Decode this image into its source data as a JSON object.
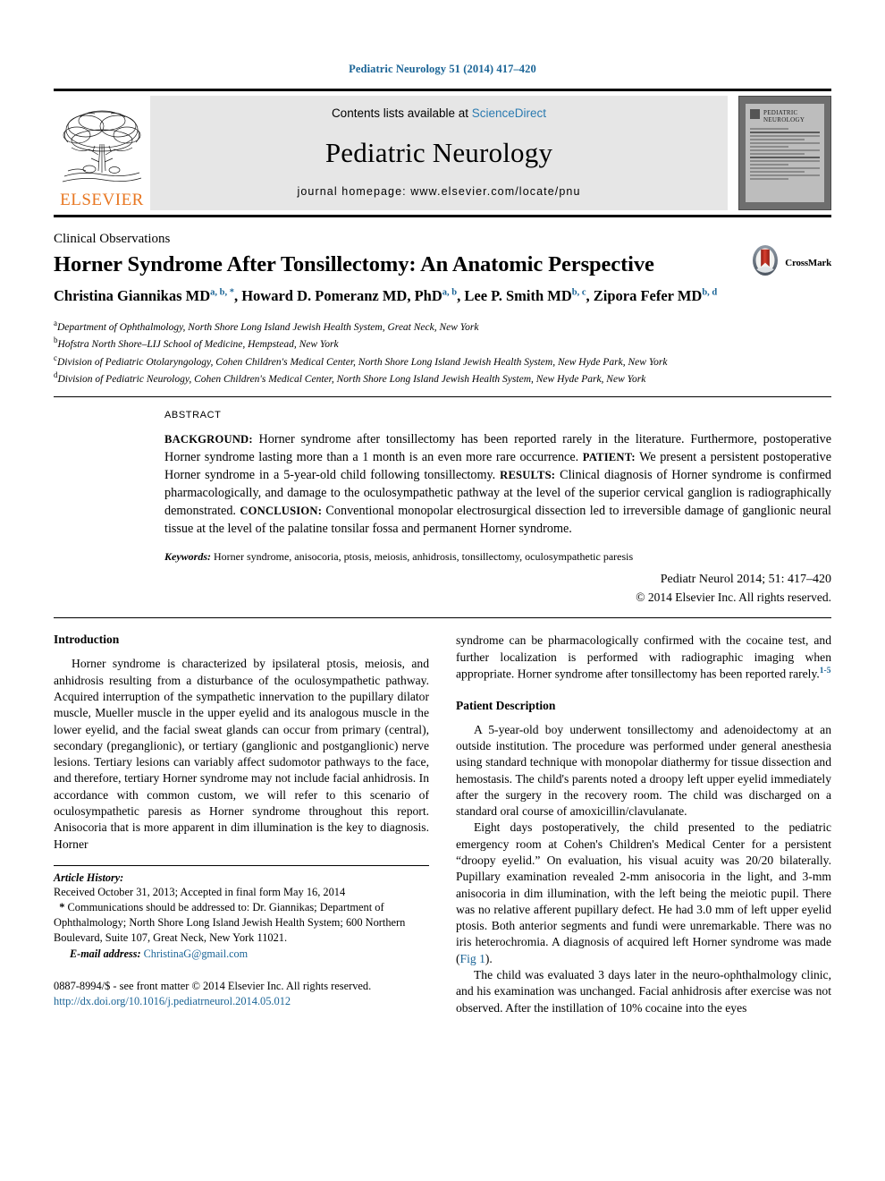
{
  "running_head": "Pediatric Neurology 51 (2014) 417–420",
  "masthead": {
    "publisher_name": "ELSEVIER",
    "contents_prefix": "Contents lists available at ",
    "contents_link": "ScienceDirect",
    "journal_title": "Pediatric Neurology",
    "homepage_line": "journal homepage: www.elsevier.com/locate/pnu",
    "cover_title_line1": "PEDIATRIC",
    "cover_title_line2": "NEUROLOGY"
  },
  "article": {
    "kicker": "Clinical Observations",
    "title": "Horner Syndrome After Tonsillectomy: An Anatomic Perspective",
    "crossmark_label": "CrossMark",
    "authors": [
      {
        "name": "Christina Giannikas MD",
        "marks": "a, b, *",
        "sep": ", "
      },
      {
        "name": "Howard D. Pomeranz MD, PhD",
        "marks": "a, b",
        "sep": ", "
      },
      {
        "name": "Lee P. Smith MD",
        "marks": "b, c",
        "sep": ", "
      },
      {
        "name": "Zipora Fefer MD",
        "marks": "b, d",
        "sep": ""
      }
    ],
    "affiliations": [
      {
        "mark": "a",
        "text": "Department of Ophthalmology, North Shore Long Island Jewish Health System, Great Neck, New York"
      },
      {
        "mark": "b",
        "text": "Hofstra North Shore–LIJ School of Medicine, Hempstead, New York"
      },
      {
        "mark": "c",
        "text": "Division of Pediatric Otolaryngology, Cohen Children's Medical Center, North Shore Long Island Jewish Health System, New Hyde Park, New York"
      },
      {
        "mark": "d",
        "text": "Division of Pediatric Neurology, Cohen Children's Medical Center, North Shore Long Island Jewish Health System, New Hyde Park, New York"
      }
    ]
  },
  "abstract": {
    "label": "ABSTRACT",
    "segments": [
      {
        "head": "BACKGROUND:",
        "text": " Horner syndrome after tonsillectomy has been reported rarely in the literature. Furthermore, postoperative Horner syndrome lasting more than a 1 month is an even more rare occurrence. "
      },
      {
        "head": "PATIENT:",
        "text": " We present a persistent postoperative Horner syndrome in a 5-year-old child following tonsillectomy. "
      },
      {
        "head": "RESULTS:",
        "text": " Clinical diagnosis of Horner syndrome is confirmed pharmacologically, and damage to the oculosympathetic pathway at the level of the superior cervical ganglion is radiographically demonstrated. "
      },
      {
        "head": "CONCLUSION:",
        "text": " Conventional monopolar electrosurgical dissection led to irreversible damage of ganglionic neural tissue at the level of the palatine tonsilar fossa and permanent Horner syndrome."
      }
    ],
    "keywords_label": "Keywords:",
    "keywords": " Horner syndrome, anisocoria, ptosis, meiosis, anhidrosis, tonsillectomy, oculosympathetic paresis",
    "citation": "Pediatr Neurol 2014; 51: 417–420",
    "copyright": "© 2014 Elsevier Inc. All rights reserved."
  },
  "left_column": {
    "heading": "Introduction",
    "paragraph1": "Horner syndrome is characterized by ipsilateral ptosis, meiosis, and anhidrosis resulting from a disturbance of the oculosympathetic pathway. Acquired interruption of the sympathetic innervation to the pupillary dilator muscle, Mueller muscle in the upper eyelid and its analogous muscle in the lower eyelid, and the facial sweat glands can occur from primary (central), secondary (preganglionic), or tertiary (ganglionic and postganglionic) nerve lesions. Tertiary lesions can variably affect sudomotor pathways to the face, and therefore, tertiary Horner syndrome may not include facial anhidrosis. In accordance with common custom, we will refer to this scenario of oculosympathetic paresis as Horner syndrome throughout this report. Anisocoria that is more apparent in dim illumination is the key to diagnosis. Horner",
    "article_history_label": "Article History:",
    "article_history_dates": "Received October 31, 2013; Accepted in final form May 16, 2014",
    "correspondence": "Communications should be addressed to: Dr. Giannikas; Department of Ophthalmology; North Shore Long Island Jewish Health System; 600 Northern Boulevard, Suite 107, Great Neck, New York 11021.",
    "email_label": "E-mail address:",
    "email": "ChristinaG@gmail.com",
    "issn_line": "0887-8994/$ - see front matter © 2014 Elsevier Inc. All rights reserved.",
    "doi_line": "http://dx.doi.org/10.1016/j.pediatrneurol.2014.05.012"
  },
  "right_column": {
    "paragraph_cont": "syndrome can be pharmacologically confirmed with the cocaine test, and further localization is performed with radiographic imaging when appropriate. Horner syndrome after tonsillectomy has been reported rarely.",
    "paragraph_cont_ref": "1-5",
    "heading": "Patient Description",
    "paragraph1": "A 5-year-old boy underwent tonsillectomy and adenoidectomy at an outside institution. The procedure was performed under general anesthesia using standard technique with monopolar diathermy for tissue dissection and hemostasis. The child's parents noted a droopy left upper eyelid immediately after the surgery in the recovery room. The child was discharged on a standard oral course of amoxicillin/clavulanate.",
    "paragraph2_a": "Eight days postoperatively, the child presented to the pediatric emergency room at Cohen's Children's Medical Center for a persistent “droopy eyelid.” On evaluation, his visual acuity was 20/20 bilaterally. Pupillary examination revealed 2-mm anisocoria in the light, and 3-mm anisocoria in dim illumination, with the left being the meiotic pupil. There was no relative afferent pupillary defect. He had 3.0 mm of left upper eyelid ptosis. Both anterior segments and fundi were unremarkable. There was no iris heterochromia. A diagnosis of acquired left Horner syndrome was made (",
    "paragraph2_figref": "Fig 1",
    "paragraph2_b": ").",
    "paragraph3": "The child was evaluated 3 days later in the neuro-ophthalmology clinic, and his examination was unchanged. Facial anhidrosis after exercise was not observed. After the instillation of 10% cocaine into the eyes"
  },
  "colors": {
    "link_blue": "#1a6496",
    "sciencedirect_blue": "#2a7ab0",
    "elsevier_orange": "#E87722",
    "crossmark_red": "#b5261e"
  }
}
